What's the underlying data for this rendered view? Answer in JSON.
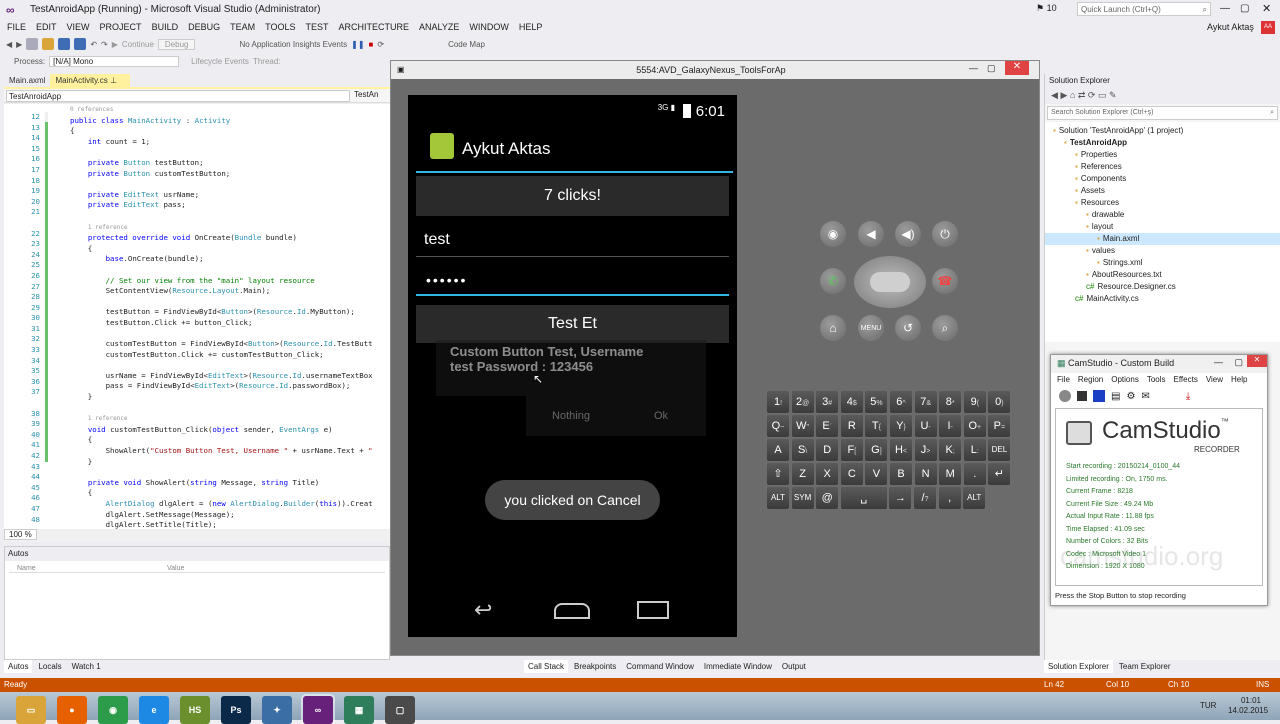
{
  "vs": {
    "title": "TestAnroidApp (Running) - Microsoft Visual Studio (Administrator)",
    "notif_count": "10",
    "quick_launch": "Quick Launch (Ctrl+Q)",
    "user": "Aykut Aktaş",
    "avatar": "AA",
    "menu": [
      "FILE",
      "EDIT",
      "VIEW",
      "PROJECT",
      "BUILD",
      "DEBUG",
      "TEAM",
      "TOOLS",
      "TEST",
      "ARCHITECTURE",
      "ANALYZE",
      "WINDOW",
      "HELP"
    ],
    "continue_label": "Continue",
    "debug_combo": "Debug",
    "app_insights": "No Application Insights Events",
    "code_map": "Code Map",
    "process_label": "Process:",
    "process_value": "[N/A] Mono",
    "lifecycle_label": "Lifecycle Events",
    "thread_label": "Thread:",
    "tabs": [
      "Main.axml",
      "MainActivity.cs"
    ],
    "nav_combo": "TestAnroidApp",
    "nav_combo2": "TestAn",
    "zoom": "100 %",
    "ref_label_0": "0 references",
    "ref_label_1": "1 reference",
    "line_numbers": [
      "12",
      "13",
      "14",
      "15",
      "16",
      "17",
      "18",
      "19",
      "20",
      "21",
      "22",
      "23",
      "24",
      "25",
      "26",
      "27",
      "28",
      "29",
      "30",
      "31",
      "32",
      "33",
      "34",
      "35",
      "36",
      "37",
      "38",
      "39",
      "40",
      "41",
      "42",
      "43",
      "44",
      "45",
      "46",
      "47",
      "48"
    ],
    "autos_title": "Autos",
    "autos_cols": [
      "Name",
      "Value"
    ],
    "bottom_tabs_left": [
      "Autos",
      "Locals",
      "Watch 1"
    ],
    "bottom_tabs_right": [
      "Call Stack",
      "Breakpoints",
      "Command Window",
      "Immediate Window",
      "Output"
    ],
    "status": {
      "ready": "Ready",
      "ln": "Ln 42",
      "col": "Col 10",
      "ch": "Ch 10",
      "ins": "INS"
    }
  },
  "emulator": {
    "title": "5554:AVD_GalaxyNexus_ToolsForAp",
    "clock": "6:01",
    "signal": "3G",
    "app_name": "Aykut Aktas",
    "clicks_button": "7 clicks!",
    "username_value": "test",
    "password_value": "••••••",
    "testet_button": "Test Et",
    "ghost_line1": "Custom Button Test, Username",
    "ghost_line2": "test Password : 123456",
    "ghost_btn1": "Nothing",
    "ghost_btn2": "Ok",
    "toast": "you clicked on Cancel",
    "keyboard_rows": [
      [
        {
          "k": "1",
          "s": "!"
        },
        {
          "k": "2",
          "s": "@"
        },
        {
          "k": "3",
          "s": "#"
        },
        {
          "k": "4",
          "s": "$"
        },
        {
          "k": "5",
          "s": "%"
        },
        {
          "k": "6",
          "s": "^"
        },
        {
          "k": "7",
          "s": "&"
        },
        {
          "k": "8",
          "s": "*"
        },
        {
          "k": "9",
          "s": "("
        },
        {
          "k": "0",
          "s": ")"
        }
      ],
      [
        {
          "k": "Q",
          "s": "~"
        },
        {
          "k": "W",
          "s": "\""
        },
        {
          "k": "E",
          "s": "´"
        },
        {
          "k": "R",
          "s": ""
        },
        {
          "k": "T",
          "s": "{"
        },
        {
          "k": "Y",
          "s": "}"
        },
        {
          "k": "U",
          "s": "-"
        },
        {
          "k": "I",
          "s": "-"
        },
        {
          "k": "O",
          "s": "+"
        },
        {
          "k": "P",
          "s": "="
        }
      ],
      [
        {
          "k": "A",
          "s": ""
        },
        {
          "k": "S",
          "s": "\\"
        },
        {
          "k": "D",
          "s": ""
        },
        {
          "k": "F",
          "s": "["
        },
        {
          "k": "G",
          "s": "]"
        },
        {
          "k": "H",
          "s": "<"
        },
        {
          "k": "J",
          "s": ">"
        },
        {
          "k": "K",
          "s": ";"
        },
        {
          "k": "L",
          "s": ":"
        },
        {
          "k": "DEL",
          "s": ""
        }
      ],
      [
        {
          "k": "⇧",
          "s": ""
        },
        {
          "k": "Z",
          "s": ""
        },
        {
          "k": "X",
          "s": ""
        },
        {
          "k": "C",
          "s": ""
        },
        {
          "k": "V",
          "s": ""
        },
        {
          "k": "B",
          "s": ""
        },
        {
          "k": "N",
          "s": ""
        },
        {
          "k": "M",
          "s": ""
        },
        {
          "k": ".",
          "s": ""
        },
        {
          "k": "↵",
          "s": ""
        }
      ],
      [
        {
          "k": "ALT",
          "s": ""
        },
        {
          "k": "SYM",
          "s": ""
        },
        {
          "k": "@",
          "s": ""
        },
        {
          "k": "␣",
          "s": ""
        },
        {
          "k": "→",
          "s": ""
        },
        {
          "k": "/",
          "s": "?"
        },
        {
          "k": ",",
          "s": ""
        },
        {
          "k": "ALT",
          "s": ""
        }
      ]
    ]
  },
  "solution": {
    "title": "Solution Explorer",
    "search": "Search Solution Explorer (Ctrl+ş)",
    "items": [
      {
        "t": "Solution 'TestAnroidApp' (1 project)",
        "d": 0
      },
      {
        "t": "TestAnroidApp",
        "d": 1,
        "b": true
      },
      {
        "t": "Properties",
        "d": 2
      },
      {
        "t": "References",
        "d": 2
      },
      {
        "t": "Components",
        "d": 2
      },
      {
        "t": "Assets",
        "d": 2
      },
      {
        "t": "Resources",
        "d": 2
      },
      {
        "t": "drawable",
        "d": 3
      },
      {
        "t": "layout",
        "d": 3
      },
      {
        "t": "Main.axml",
        "d": 4,
        "sel": true
      },
      {
        "t": "values",
        "d": 3
      },
      {
        "t": "Strings.xml",
        "d": 4
      },
      {
        "t": "AboutResources.txt",
        "d": 3
      },
      {
        "t": "Resource.Designer.cs",
        "d": 3
      },
      {
        "t": "MainActivity.cs",
        "d": 2
      }
    ],
    "tabs": [
      "Solution Explorer",
      "Team Explorer"
    ]
  },
  "camstudio": {
    "title": "CamStudio - Custom Build",
    "menu": [
      "File",
      "Region",
      "Options",
      "Tools",
      "Effects",
      "View",
      "Help"
    ],
    "logo": "CamStudio",
    "tm": "™",
    "recorder": "RECORDER",
    "watermark": "camstudio.org",
    "stats": [
      "Start recording : 20150214_0100_44",
      "Limited recording : On, 1750 ms.",
      "Current Frame : 8218",
      "Current File Size : 49.24 Mb",
      "Actual Input Rate : 11.88 fps",
      "Time Elapsed : 41.09 sec",
      "Number of Colors : 32 Bits",
      "Codec : Microsoft Video 1",
      "Dimension : 1920 X 1080"
    ],
    "status": "Press the Stop Button to stop recording"
  },
  "taskbar": {
    "lang": "TUR",
    "time": "01:01",
    "date": "14.02.2015",
    "apps": [
      {
        "n": "explorer",
        "c": "#d9a43a",
        "l": "▭"
      },
      {
        "n": "firefox",
        "c": "#e66000",
        "l": "●"
      },
      {
        "n": "chrome",
        "c": "#2d9c4a",
        "l": "◉"
      },
      {
        "n": "ie",
        "c": "#1e88e5",
        "l": "e"
      },
      {
        "n": "hs",
        "c": "#6a8f2c",
        "l": "HS"
      },
      {
        "n": "photoshop",
        "c": "#0b2a4a",
        "l": "Ps"
      },
      {
        "n": "tool",
        "c": "#3b6ea5",
        "l": "✦"
      },
      {
        "n": "visualstudio",
        "c": "#68217a",
        "l": "∞"
      },
      {
        "n": "camstudio",
        "c": "#2e7d5b",
        "l": "▦"
      },
      {
        "n": "emulator",
        "c": "#4a4a4a",
        "l": "▢"
      }
    ]
  }
}
